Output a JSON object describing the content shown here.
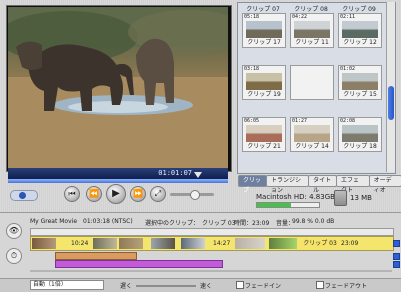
{
  "monitor": {
    "timecode": "01:01:07"
  },
  "shelf": {
    "top_labels": [
      "クリップ 07",
      "クリップ 08",
      "クリップ 09"
    ],
    "clips": [
      {
        "duration": "05:18",
        "name": "クリップ 17",
        "colors": [
          "#b6c2cc",
          "#6f6a5a"
        ]
      },
      {
        "duration": "04:22",
        "name": "クリップ 11",
        "colors": [
          "#cfd3d6",
          "#7b7565"
        ]
      },
      {
        "duration": "02:11",
        "name": "クリップ 12",
        "colors": [
          "#c2cbd0",
          "#5a6b63"
        ]
      },
      {
        "duration": "03:18",
        "name": "クリップ 19",
        "colors": [
          "#c9c0a8",
          "#7e6b48"
        ]
      },
      {
        "duration": "",
        "name": "",
        "colors": [
          "#f2f2f2",
          "#f2f2f2"
        ]
      },
      {
        "duration": "01:02",
        "name": "クリップ 15",
        "colors": [
          "#bfc6c7",
          "#8c7f68"
        ]
      },
      {
        "duration": "06:05",
        "name": "クリップ 21",
        "colors": [
          "#d8cfc0",
          "#a86e5a"
        ]
      },
      {
        "duration": "01:27",
        "name": "クリップ 14",
        "colors": [
          "#d6d0c3",
          "#b7a58a"
        ]
      },
      {
        "duration": "02:08",
        "name": "クリップ 18",
        "colors": [
          "#b9c4c6",
          "#7d7b6d"
        ]
      }
    ]
  },
  "tabs": [
    "クリップ",
    "トランジション",
    "タイトル",
    "エフェクト",
    "オーディオ"
  ],
  "disk": {
    "label": "Macintosh HD: 4.83GB",
    "used_fraction": 0.55,
    "free": "13 MB"
  },
  "timeline": {
    "movie_name": "My Great Movie",
    "time": "01:03:18 (NTSC)",
    "selected_label": "選択中のクリップ：",
    "clip_name": "クリップ 03",
    "time_label": "時間：23:09",
    "volume_label": "音量：",
    "volume_value": "99.8 % 0.0 dB",
    "clip_time_a": "10:24",
    "clip_time_b": "14:27",
    "clip_selected": "クリップ 03",
    "clip_selected_time": "23:09"
  },
  "bottom": {
    "zoom": "自動（1倍）",
    "slow": "遅く",
    "fast": "速く",
    "fade_in": "フェードイン",
    "fade_out": "フェードアウト"
  }
}
